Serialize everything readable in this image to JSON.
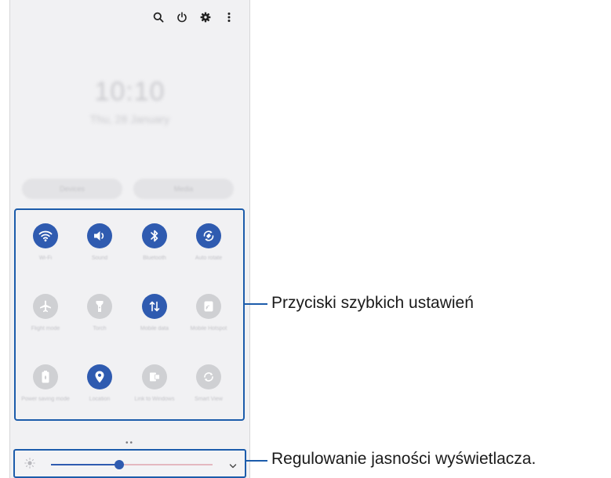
{
  "topbar": {
    "icons": [
      "search-icon",
      "power-icon",
      "gear-icon",
      "more-vert-icon"
    ]
  },
  "lockscreen": {
    "time": "10:10",
    "date": "Thu, 28 January",
    "buttons": [
      "Devices",
      "Media"
    ]
  },
  "quick_settings": {
    "tiles": [
      {
        "label": "Wi-Fi",
        "icon": "wifi-icon",
        "state": "on"
      },
      {
        "label": "Sound",
        "icon": "sound-icon",
        "state": "on"
      },
      {
        "label": "Bluetooth",
        "icon": "bluetooth-icon",
        "state": "on"
      },
      {
        "label": "Auto rotate",
        "icon": "auto-rotate-icon",
        "state": "on"
      },
      {
        "label": "Flight mode",
        "icon": "airplane-icon",
        "state": "off"
      },
      {
        "label": "Torch",
        "icon": "flashlight-icon",
        "state": "off"
      },
      {
        "label": "Mobile data",
        "icon": "mobile-data-icon",
        "state": "on"
      },
      {
        "label": "Mobile Hotspot",
        "icon": "hotspot-icon",
        "state": "off"
      },
      {
        "label": "Power saving mode",
        "icon": "battery-icon",
        "state": "off"
      },
      {
        "label": "Location",
        "icon": "location-icon",
        "state": "on"
      },
      {
        "label": "Link to Windows",
        "icon": "link-windows-icon",
        "state": "off"
      },
      {
        "label": "Smart View",
        "icon": "smart-view-icon",
        "state": "off"
      }
    ]
  },
  "pager": "••",
  "brightness": {
    "level": 0.42
  },
  "callouts": {
    "quick_settings": "Przyciski szybkich ustawień",
    "brightness": "Regulowanie jasności wyświetlacza."
  },
  "colors": {
    "accent": "#2f5bb0",
    "highlight_border": "#1c5cab",
    "panel_bg": "#f1f1f3"
  }
}
